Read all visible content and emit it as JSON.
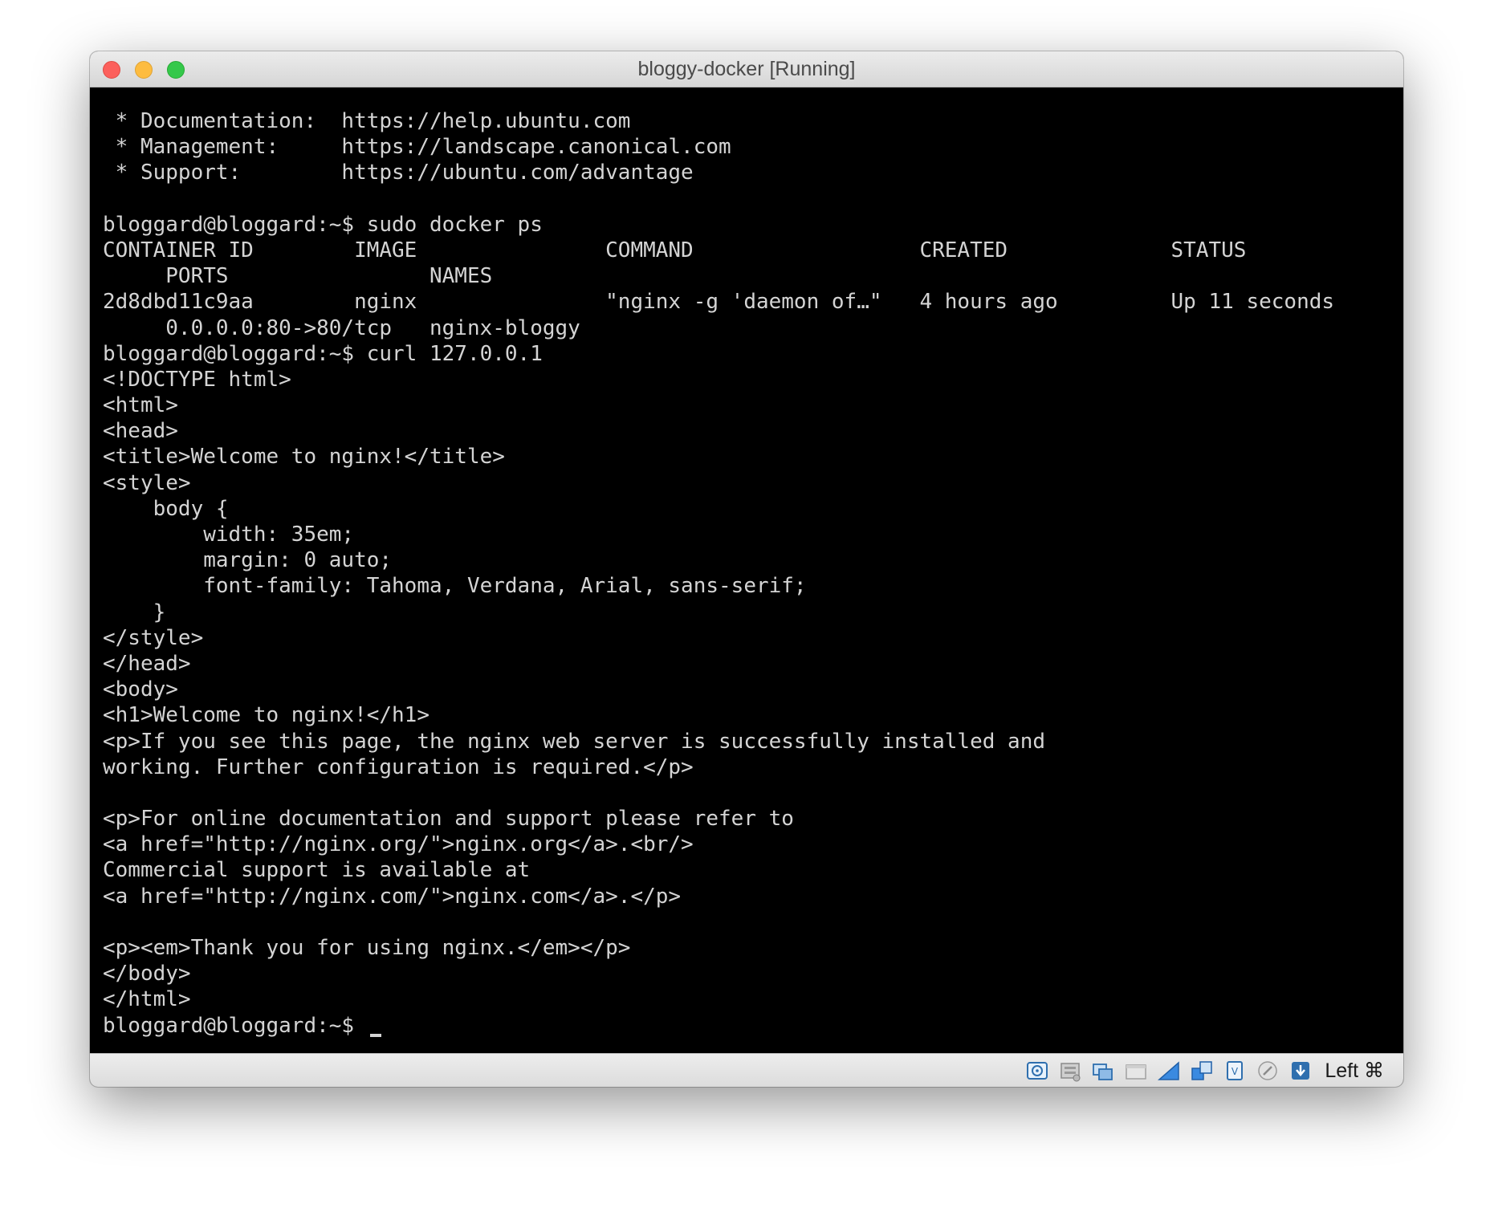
{
  "window": {
    "title": "bloggy-docker [Running]"
  },
  "terminal": {
    "lines": [
      " * Documentation:  https://help.ubuntu.com",
      " * Management:     https://landscape.canonical.com",
      " * Support:        https://ubuntu.com/advantage",
      "",
      "bloggard@bloggard:~$ sudo docker ps",
      "CONTAINER ID        IMAGE               COMMAND                  CREATED             STATUS",
      "     PORTS                NAMES",
      "2d8dbd11c9aa        nginx               \"nginx -g 'daemon of…\"   4 hours ago         Up 11 seconds",
      "     0.0.0.0:80->80/tcp   nginx-bloggy",
      "bloggard@bloggard:~$ curl 127.0.0.1",
      "<!DOCTYPE html>",
      "<html>",
      "<head>",
      "<title>Welcome to nginx!</title>",
      "<style>",
      "    body {",
      "        width: 35em;",
      "        margin: 0 auto;",
      "        font-family: Tahoma, Verdana, Arial, sans-serif;",
      "    }",
      "</style>",
      "</head>",
      "<body>",
      "<h1>Welcome to nginx!</h1>",
      "<p>If you see this page, the nginx web server is successfully installed and",
      "working. Further configuration is required.</p>",
      "",
      "<p>For online documentation and support please refer to",
      "<a href=\"http://nginx.org/\">nginx.org</a>.<br/>",
      "Commercial support is available at",
      "<a href=\"http://nginx.com/\">nginx.com</a>.</p>",
      "",
      "<p><em>Thank you for using nginx.</em></p>",
      "</body>",
      "</html>"
    ],
    "prompt": "bloggard@bloggard:~$ "
  },
  "statusbar": {
    "icons": [
      "hard-disk-icon",
      "optical-drive-icon",
      "audio-icon",
      "network-icon",
      "usb-icon",
      "shared-folders-icon",
      "display-icon",
      "video-capture-icon",
      "cpu-icon",
      "mouse-integration-icon",
      "keyboard-capture-icon"
    ],
    "host_key": "Left ⌘"
  }
}
